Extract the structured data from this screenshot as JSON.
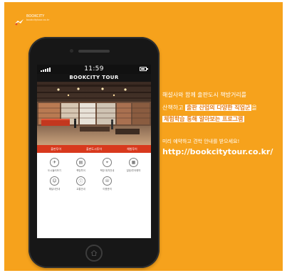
{
  "brand": {
    "logo_text": "BOOKCITY",
    "logo_sub": "bookcitytour.co.kr"
  },
  "phone": {
    "status_time": "11:59",
    "app_title": "BOOKCITY TOUR",
    "menu": [
      "출판투어",
      "출판도시투어",
      "체험투어"
    ],
    "grid_items": [
      {
        "icon": "tour-icon",
        "glyph": "✈",
        "label": "도시둘러보기"
      },
      {
        "icon": "book-icon",
        "glyph": "▤",
        "label": "책방투어"
      },
      {
        "icon": "map-icon",
        "glyph": "⌖",
        "label": "책방 위치안내"
      },
      {
        "icon": "calendar-icon",
        "glyph": "▦",
        "label": "일정/투어예약"
      },
      {
        "icon": "person-icon",
        "glyph": "☺",
        "label": "해설사안내"
      },
      {
        "icon": "info-icon",
        "glyph": "ⓘ",
        "label": "교통안내"
      },
      {
        "icon": "phone-icon",
        "glyph": "☏",
        "label": "이용문의"
      }
    ]
  },
  "copy": {
    "line1": "해설사와 함께 출판도시 책방거리를",
    "line2_pre": "산책하고 ",
    "line2_hl": "출판 산업의 다양한 직업군",
    "line2_post": "을",
    "line3_hl": "체험학습 통해 알아보는 프로그램",
    "reserve": "미리 예약하고 견학 안내를 받으세요!",
    "url": "http://bookcitytour.co.kr/"
  },
  "colors": {
    "background": "#f6a21c",
    "accent_red": "#d8391d",
    "highlight_text": "#e8811a"
  }
}
